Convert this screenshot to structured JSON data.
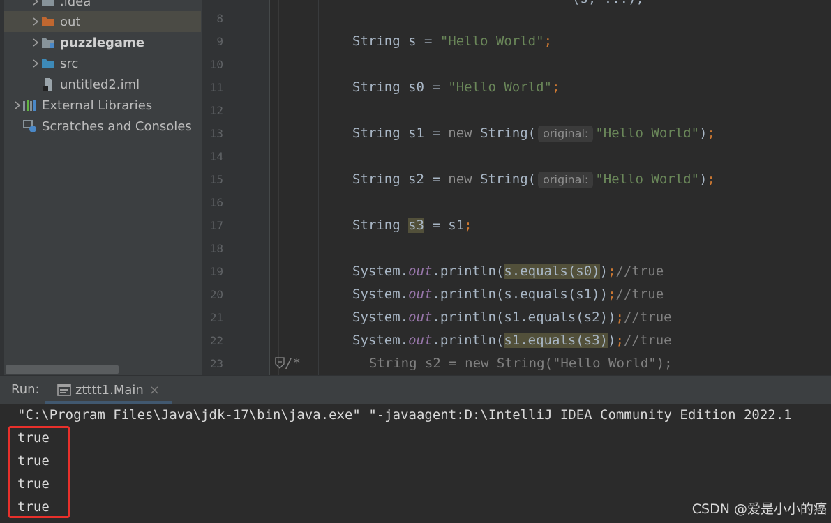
{
  "project_tree": {
    "items": [
      {
        "label": ".idea",
        "type": "folder",
        "bold": false,
        "expandable": true
      },
      {
        "label": "out",
        "type": "folder-orange",
        "bold": false,
        "expandable": true,
        "selected": true
      },
      {
        "label": "puzzlegame",
        "type": "module",
        "bold": true,
        "expandable": true
      },
      {
        "label": "src",
        "type": "folder-blue",
        "bold": false,
        "expandable": true
      },
      {
        "label": "untitled2.iml",
        "type": "file",
        "bold": false,
        "expandable": false
      },
      {
        "label": "External Libraries",
        "type": "libraries",
        "bold": false,
        "expandable": true
      },
      {
        "label": "Scratches and Consoles",
        "type": "scratches",
        "bold": false,
        "expandable": false
      }
    ]
  },
  "editor": {
    "line_numbers": [
      "8",
      "9",
      "10",
      "11",
      "12",
      "13",
      "14",
      "15",
      "16",
      "17",
      "18",
      "19",
      "20",
      "21",
      "22",
      "23"
    ],
    "top_fragment": "(s, ...);",
    "lines": {
      "l9_decl": "String s = ",
      "l9_str": "\"Hello World\"",
      "l11_decl": "String s0 = ",
      "l11_str": "\"Hello World\"",
      "l13_decl": "String s1 = ",
      "l13_new": "new",
      "l13_type": " String(",
      "l13_hint": "original:",
      "l13_str": "\"Hello World\"",
      "l15_decl": "String s2 = ",
      "l15_new": "new",
      "l15_type": " String(",
      "l15_hint": "original:",
      "l15_str": "\"Hello World\"",
      "l17_decl": "String ",
      "l17_var": "s3",
      "l17_rest": " = s1",
      "l19_pre": "System.",
      "l19_out": "out",
      "l19_call": ".println(",
      "l19_expr": "s.equals(s0)",
      "l19_post": ")",
      "l19_comment": "//true",
      "l20_pre": "System.",
      "l20_out": "out",
      "l20_call": ".println(s.equals(s1))",
      "l20_comment": "//true",
      "l21_pre": "System.",
      "l21_out": "out",
      "l21_call": ".println(s1.equals(s2))",
      "l21_comment": "//true",
      "l22_pre": "System.",
      "l22_out": "out",
      "l22_call": ".println(",
      "l22_expr": "s1.equals(s3)",
      "l22_post": ")",
      "l22_comment": "//true",
      "l23_comment_open": "/*",
      "l23_text": "String s2 = new String(\"Hello World\");"
    }
  },
  "run_panel": {
    "label": "Run:",
    "tab_title": "ztttt1.Main",
    "tab_close": "×",
    "console_lines": [
      "\"C:\\Program Files\\Java\\jdk-17\\bin\\java.exe\" \"-javaagent:D:\\IntelliJ IDEA Community Edition 2022.1",
      "true",
      "true",
      "true",
      "true"
    ]
  },
  "watermark": "CSDN @爱是小小的癌",
  "colors": {
    "editor_bg": "#2b2b2b",
    "panel_bg": "#3c3f41",
    "string": "#6a8759",
    "keyword": "#cc7832",
    "field": "#9876aa",
    "comment": "#808080",
    "highlight_box": "#e8302b"
  }
}
